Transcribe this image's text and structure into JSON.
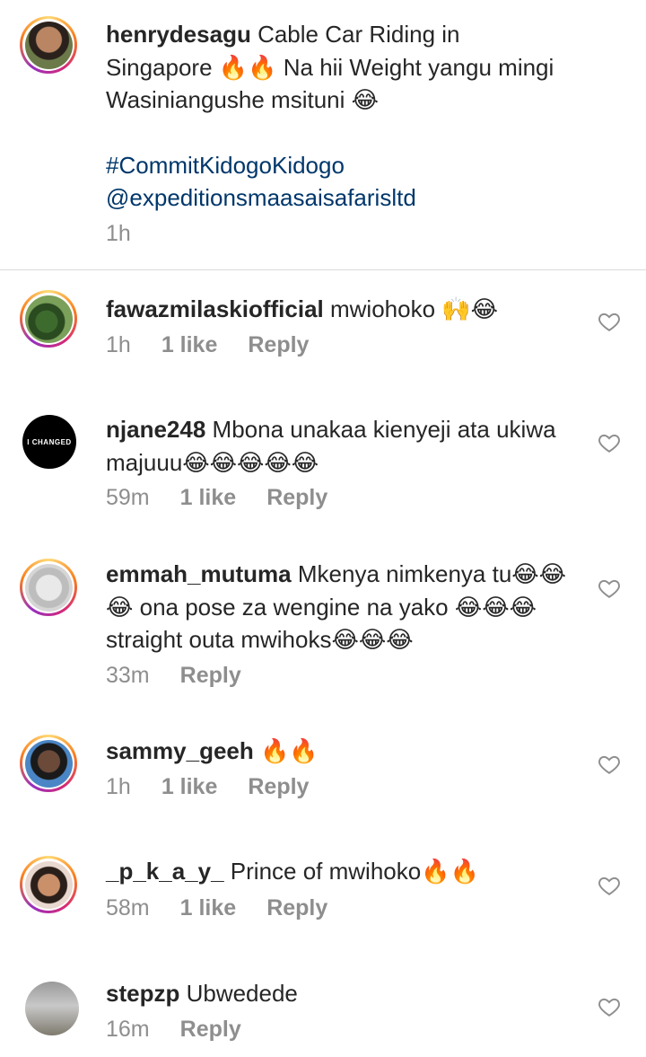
{
  "caption": {
    "username": "henrydesagu",
    "text": "Cable Car Riding in Singapore 🔥🔥 Na hii Weight yangu mingi Wasiniangushe msituni 😂",
    "hashtag": "#CommitKidogoKidogo",
    "mention": "@expeditionsmaasaisafarisltd",
    "time": "1h"
  },
  "comments": [
    {
      "username": "fawazmilaskiofficial",
      "text": "mwiohoko 🙌😂",
      "time": "1h",
      "likes": "1 like",
      "reply": "Reply"
    },
    {
      "username": "njane248",
      "text": "Mbona unakaa kienyeji ata ukiwa majuuu😂😂😂😂😂",
      "time": "59m",
      "likes": "1 like",
      "reply": "Reply",
      "avatar_label": "I CHANGED"
    },
    {
      "username": "emmah_mutuma",
      "text": "Mkenya nimkenya tu😂😂😂 ona pose za wengine na yako 😂😂😂straight outa mwihoks😂😂😂",
      "time": "33m",
      "reply": "Reply"
    },
    {
      "username": "sammy_geeh",
      "text": "🔥🔥",
      "time": "1h",
      "likes": "1 like",
      "reply": "Reply"
    },
    {
      "username": "_p_k_a_y_",
      "text": "Prince of mwihoko🔥🔥",
      "time": "58m",
      "likes": "1 like",
      "reply": "Reply"
    },
    {
      "username": "stepzp",
      "text": "Ubwedede",
      "time": "16m",
      "reply": "Reply"
    }
  ],
  "colors": {
    "link": "#00376b",
    "meta": "#8e8e8e",
    "divider": "#dbdbdb"
  },
  "icons": {
    "like": "heart-outline-icon"
  }
}
